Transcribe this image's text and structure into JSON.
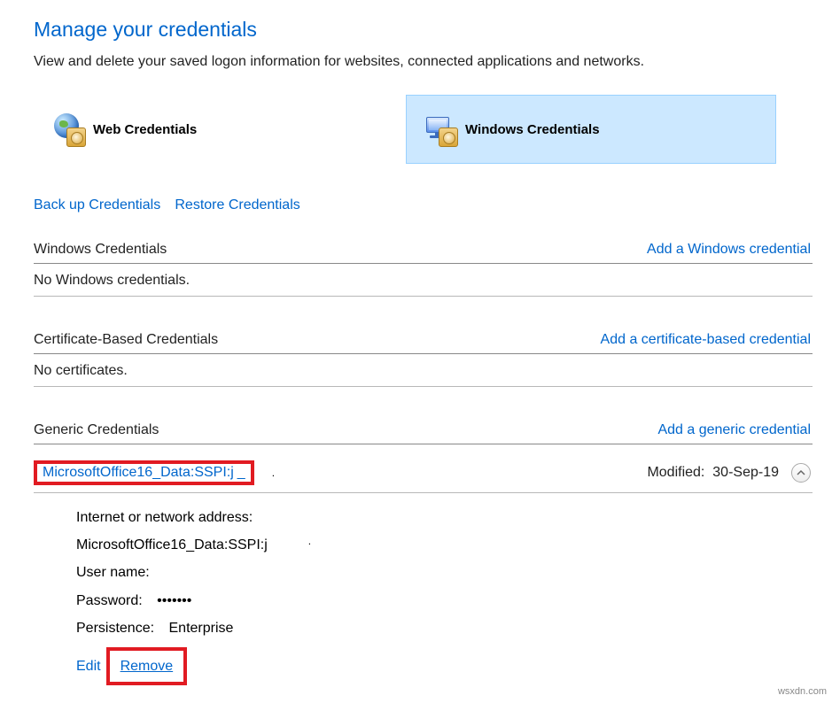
{
  "title": "Manage your credentials",
  "subtitle": "View and delete your saved logon information for websites, connected applications and networks.",
  "tabs": {
    "web": "Web Credentials",
    "windows": "Windows Credentials"
  },
  "links": {
    "backup": "Back up Credentials",
    "restore": "Restore Credentials"
  },
  "sections": {
    "windows": {
      "header": "Windows Credentials",
      "add": "Add a Windows credential",
      "empty": "No Windows credentials."
    },
    "cert": {
      "header": "Certificate-Based Credentials",
      "add": "Add a certificate-based credential",
      "empty": "No certificates."
    },
    "generic": {
      "header": "Generic Credentials",
      "add": "Add a generic credential"
    }
  },
  "credential": {
    "name": "MicrosoftOffice16_Data:SSPI:j",
    "modified_label": "Modified:",
    "modified_value": "30-Sep-19",
    "details": {
      "address_label": "Internet or network address",
      "address_value": "MicrosoftOffice16_Data:SSPI:j",
      "username_label": "User name",
      "username_value": "",
      "password_label": "Password",
      "password_value": "•••••••",
      "persistence_label": "Persistence",
      "persistence_value": "Enterprise"
    },
    "actions": {
      "edit": "Edit",
      "remove": "Remove"
    }
  },
  "watermark": "wsxdn.com"
}
